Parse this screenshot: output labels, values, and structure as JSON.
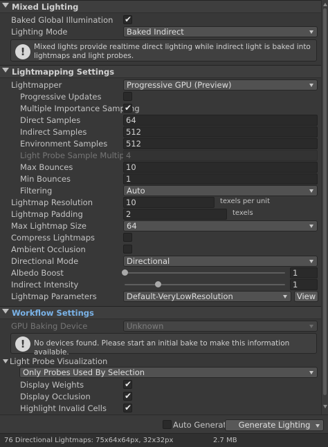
{
  "mixed_lighting": {
    "title": "Mixed Lighting",
    "baked_gi_label": "Baked Global Illumination",
    "baked_gi_checked": true,
    "lighting_mode_label": "Lighting Mode",
    "lighting_mode_value": "Baked Indirect",
    "info": "Mixed lights provide realtime direct lighting while indirect light is baked into lightmaps and light probes."
  },
  "lightmapping": {
    "title": "Lightmapping Settings",
    "lightmapper_label": "Lightmapper",
    "lightmapper_value": "Progressive GPU (Preview)",
    "progressive_updates_label": "Progressive Updates",
    "mis_label": "Multiple Importance Sampling",
    "direct_samples_label": "Direct Samples",
    "direct_samples_value": "64",
    "indirect_samples_label": "Indirect Samples",
    "indirect_samples_value": "512",
    "environment_samples_label": "Environment Samples",
    "environment_samples_value": "512",
    "light_probe_mult_label": "Light Probe Sample Multiplier",
    "light_probe_mult_value": "4",
    "max_bounces_label": "Max Bounces",
    "max_bounces_value": "10",
    "min_bounces_label": "Min Bounces",
    "min_bounces_value": "1",
    "filtering_label": "Filtering",
    "filtering_value": "Auto",
    "lightmap_resolution_label": "Lightmap Resolution",
    "lightmap_resolution_value": "10",
    "lightmap_resolution_unit": "texels per unit",
    "lightmap_padding_label": "Lightmap Padding",
    "lightmap_padding_value": "2",
    "lightmap_padding_unit": "texels",
    "max_lightmap_size_label": "Max Lightmap Size",
    "max_lightmap_size_value": "64",
    "compress_label": "Compress Lightmaps",
    "ao_label": "Ambient Occlusion",
    "directional_mode_label": "Directional Mode",
    "directional_mode_value": "Directional",
    "albedo_boost_label": "Albedo Boost",
    "albedo_boost_value": "1",
    "indirect_intensity_label": "Indirect Intensity",
    "indirect_intensity_value": "1",
    "lightmap_params_label": "Lightmap Parameters",
    "lightmap_params_value": "Default-VeryLowResolution",
    "view_label": "View"
  },
  "workflow": {
    "title": "Workflow Settings",
    "gpu_device_label": "GPU Baking Device",
    "gpu_device_value": "Unknown",
    "info": "No devices found. Please start an initial bake to make this information available.",
    "probe_vis_label": "Light Probe Visualization",
    "probe_vis_value": "Only Probes Used By Selection",
    "display_weights_label": "Display Weights",
    "display_occlusion_label": "Display Occlusion",
    "highlight_invalid_label": "Highlight Invalid Cells"
  },
  "footer": {
    "auto_generate_label": "Auto Generate",
    "generate_button_label": "Generate Lighting",
    "status_left": "76 Directional Lightmaps: 75x64x64px, 32x32px",
    "status_right": "2.7 MB"
  },
  "check_glyph": "✔",
  "info_glyph": "!"
}
